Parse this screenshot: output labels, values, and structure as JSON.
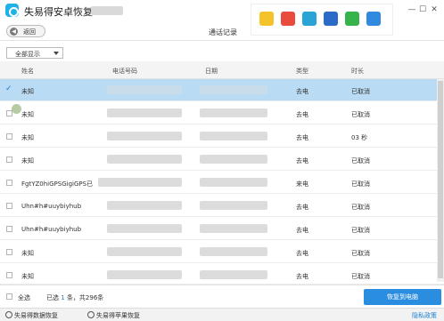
{
  "app": {
    "title": "失易得安卓恢复"
  },
  "toolbar": {
    "back_label": "返回",
    "page_title": "通话记录"
  },
  "filter": {
    "selected": "全部显示"
  },
  "table": {
    "columns": [
      "姓名",
      "电话号码",
      "日期",
      "类型",
      "时长"
    ],
    "rows": [
      {
        "name": "未知",
        "type": "去电",
        "duration": "已取消",
        "selected": true
      },
      {
        "name": "未知",
        "type": "去电",
        "duration": "已取消",
        "selected": false
      },
      {
        "name": "未知",
        "type": "去电",
        "duration": "03 秒",
        "selected": false
      },
      {
        "name": "未知",
        "type": "去电",
        "duration": "已取消",
        "selected": false
      },
      {
        "name": "FgtYZ0hiGPSGigiGPS已",
        "type": "来电",
        "duration": "已取消",
        "selected": false
      },
      {
        "name": "Uhn#h#uuybiyhub",
        "type": "去电",
        "duration": "已取消",
        "selected": false
      },
      {
        "name": "Uhn#h#uuybiyhub",
        "type": "去电",
        "duration": "已取消",
        "selected": false
      },
      {
        "name": "未知",
        "type": "去电",
        "duration": "已取消",
        "selected": false
      },
      {
        "name": "未知",
        "type": "去电",
        "duration": "已取消",
        "selected": false
      }
    ]
  },
  "footer": {
    "select_all": "全选",
    "summary_prefix": "已选",
    "selected_count": "1",
    "summary_suffix": "条，共296条",
    "recover_button": "恢复到电脑"
  },
  "bottom_bar": {
    "tab1": "失易得数据恢复",
    "tab2": "失易得苹果恢复",
    "privacy": "隐私政策"
  },
  "icons": {
    "share": [
      "qzone-icon",
      "weibo-icon",
      "tencent-weibo-icon",
      "renren-icon",
      "wechat-icon",
      "more-icon"
    ],
    "accent_color": "#2b8de0",
    "selected_row_color": "#b9dbf3"
  }
}
